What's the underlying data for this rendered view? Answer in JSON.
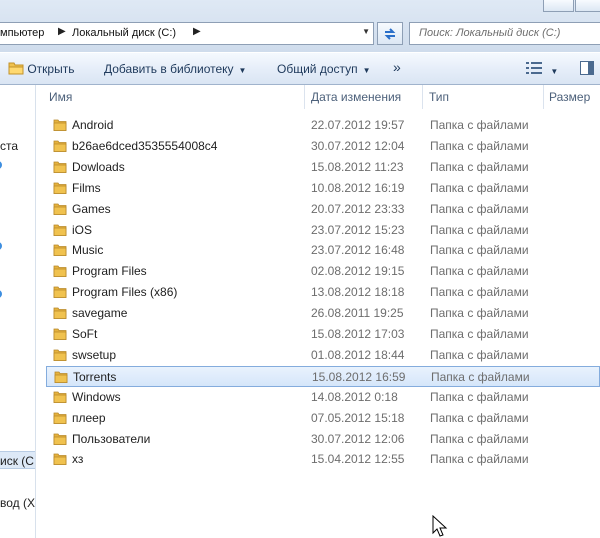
{
  "address_bar": {
    "crumbs": [
      "мпьютер",
      "Локальный диск (C:)"
    ],
    "search_placeholder": "Поиск: Локальный диск (C:)"
  },
  "toolbar": {
    "open_label": "Открыть",
    "library_label": "Добавить в библиотеку",
    "share_label": "Общий доступ",
    "more_label": "»"
  },
  "nav_pane": {
    "fragments": [
      "ста",
      "иск (C",
      "вод (X"
    ]
  },
  "columns": {
    "name": "Имя",
    "date": "Дата изменения",
    "type": "Тип",
    "size": "Размер"
  },
  "files": [
    {
      "name": "Android",
      "date": "22.07.2012 19:57",
      "type": "Папка с файлами"
    },
    {
      "name": "b26ae6dced3535554008c4",
      "date": "30.07.2012 12:04",
      "type": "Папка с файлами"
    },
    {
      "name": "Dowloads",
      "date": "15.08.2012 11:23",
      "type": "Папка с файлами"
    },
    {
      "name": "Films",
      "date": "10.08.2012 16:19",
      "type": "Папка с файлами"
    },
    {
      "name": "Games",
      "date": "20.07.2012 23:33",
      "type": "Папка с файлами"
    },
    {
      "name": "iOS",
      "date": "23.07.2012 15:23",
      "type": "Папка с файлами"
    },
    {
      "name": "Music",
      "date": "23.07.2012 16:48",
      "type": "Папка с файлами"
    },
    {
      "name": "Program Files",
      "date": "02.08.2012 19:15",
      "type": "Папка с файлами"
    },
    {
      "name": "Program Files (x86)",
      "date": "13.08.2012 18:18",
      "type": "Папка с файлами"
    },
    {
      "name": "savegame",
      "date": "26.08.2011 19:25",
      "type": "Папка с файлами"
    },
    {
      "name": "SoFt",
      "date": "15.08.2012 17:03",
      "type": "Папка с файлами"
    },
    {
      "name": "swsetup",
      "date": "01.08.2012 18:44",
      "type": "Папка с файлами"
    },
    {
      "name": "Torrents",
      "date": "15.08.2012 16:59",
      "type": "Папка с файлами",
      "selected": true
    },
    {
      "name": "Windows",
      "date": "14.08.2012 0:18",
      "type": "Папка с файлами"
    },
    {
      "name": "плеер",
      "date": "07.05.2012 15:18",
      "type": "Папка с файлами"
    },
    {
      "name": "Пользователи",
      "date": "30.07.2012 12:06",
      "type": "Папка с файлами"
    },
    {
      "name": "хз",
      "date": "15.04.2012 12:55",
      "type": "Папка с файлами"
    }
  ],
  "colors": {
    "folder": "#f0c24f",
    "selection_border": "#84acdd",
    "toolbar_text": "#1e395b"
  }
}
